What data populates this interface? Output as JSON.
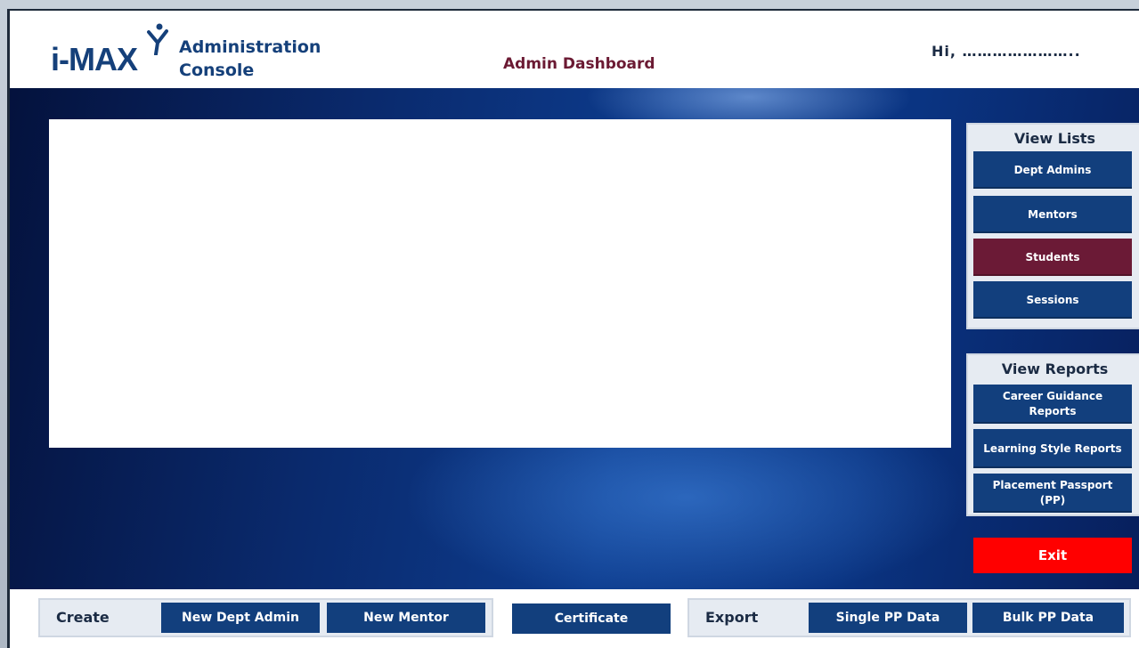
{
  "header": {
    "logo_text": "i-MAX",
    "console_title_line1": "Administration",
    "console_title_line2": "Console",
    "page_title": "Admin Dashboard",
    "greeting": "Hi, ………………….."
  },
  "view_lists": {
    "title": "View Lists",
    "items": [
      {
        "label": "Dept Admins",
        "active": false
      },
      {
        "label": "Mentors",
        "active": false
      },
      {
        "label": "Students",
        "active": true
      },
      {
        "label": "Sessions",
        "active": false
      }
    ]
  },
  "view_reports": {
    "title": "View Reports",
    "items": [
      {
        "label": "Career Guidance Reports"
      },
      {
        "label": "Learning Style Reports"
      },
      {
        "label": "Placement  Passport (PP)"
      }
    ]
  },
  "exit_label": "Exit",
  "footer": {
    "create_label": "Create",
    "new_dept_admin": "New Dept Admin",
    "new_mentor": "New Mentor",
    "certificate": "Certificate",
    "export_label": "Export",
    "single_pp": "Single PP Data",
    "bulk_pp": "Bulk PP Data"
  },
  "colors": {
    "brand_blue": "#123f7d",
    "active_maroon": "#6b1a36",
    "exit_red": "#ff0000",
    "title_maroon": "#6b1a33"
  }
}
